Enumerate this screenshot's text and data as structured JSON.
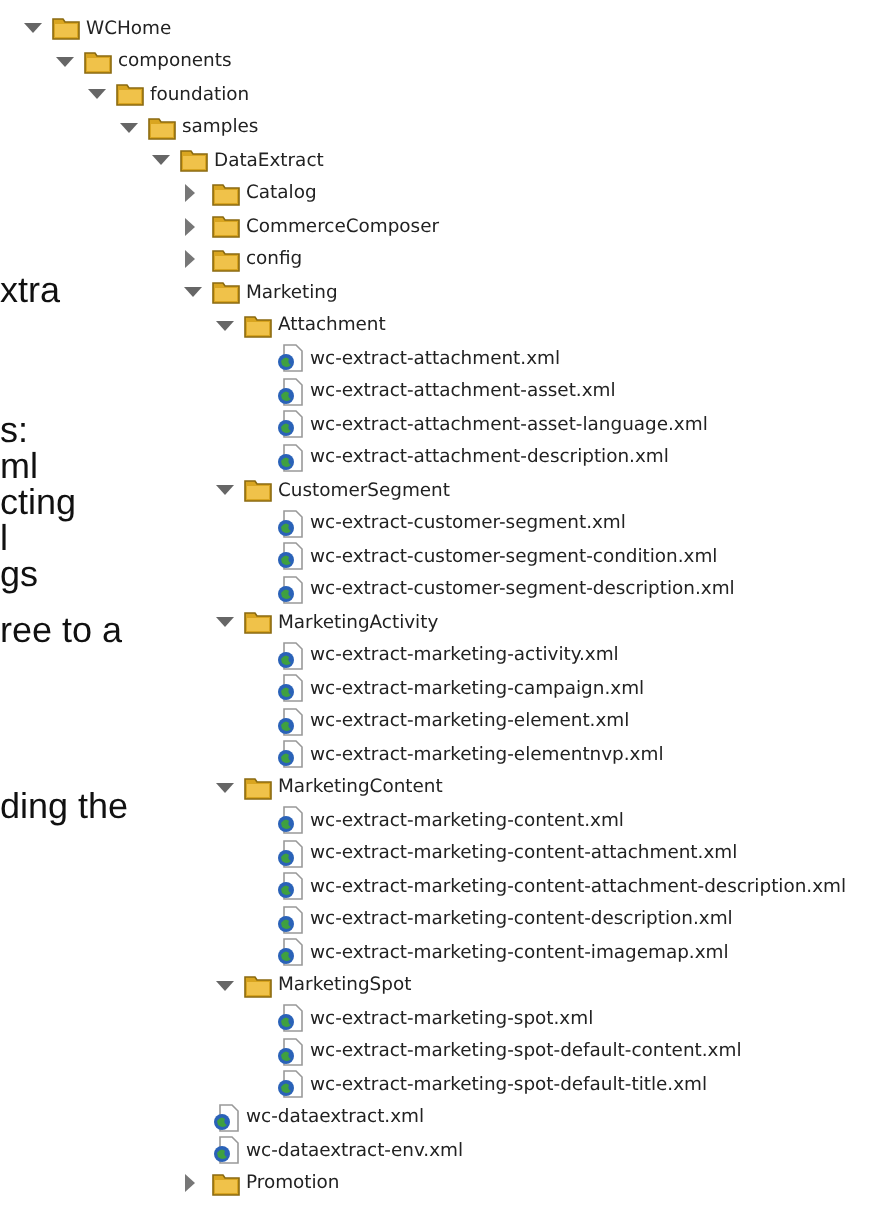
{
  "background_text": [
    "xtra",
    "s:",
    "ml",
    "cting",
    "l",
    "gs",
    "ree to a",
    "ding the"
  ],
  "tree": [
    {
      "label": "WCHome",
      "kind": "folder",
      "expanded": true,
      "children": [
        {
          "label": "components",
          "kind": "folder",
          "expanded": true,
          "children": [
            {
              "label": "foundation",
              "kind": "folder",
              "expanded": true,
              "children": [
                {
                  "label": "samples",
                  "kind": "folder",
                  "expanded": true,
                  "children": [
                    {
                      "label": "DataExtract",
                      "kind": "folder",
                      "expanded": true,
                      "children": [
                        {
                          "label": "Catalog",
                          "kind": "folder",
                          "expanded": false
                        },
                        {
                          "label": "CommerceComposer",
                          "kind": "folder",
                          "expanded": false
                        },
                        {
                          "label": "config",
                          "kind": "folder",
                          "expanded": false
                        },
                        {
                          "label": "Marketing",
                          "kind": "folder",
                          "expanded": true,
                          "children": [
                            {
                              "label": "Attachment",
                              "kind": "folder",
                              "expanded": true,
                              "children": [
                                {
                                  "label": "wc-extract-attachment.xml",
                                  "kind": "file"
                                },
                                {
                                  "label": "wc-extract-attachment-asset.xml",
                                  "kind": "file"
                                },
                                {
                                  "label": "wc-extract-attachment-asset-language.xml",
                                  "kind": "file"
                                },
                                {
                                  "label": "wc-extract-attachment-description.xml",
                                  "kind": "file"
                                }
                              ]
                            },
                            {
                              "label": "CustomerSegment",
                              "kind": "folder",
                              "expanded": true,
                              "children": [
                                {
                                  "label": "wc-extract-customer-segment.xml",
                                  "kind": "file"
                                },
                                {
                                  "label": "wc-extract-customer-segment-condition.xml",
                                  "kind": "file"
                                },
                                {
                                  "label": "wc-extract-customer-segment-description.xml",
                                  "kind": "file"
                                }
                              ]
                            },
                            {
                              "label": "MarketingActivity",
                              "kind": "folder",
                              "expanded": true,
                              "children": [
                                {
                                  "label": "wc-extract-marketing-activity.xml",
                                  "kind": "file"
                                },
                                {
                                  "label": "wc-extract-marketing-campaign.xml",
                                  "kind": "file"
                                },
                                {
                                  "label": "wc-extract-marketing-element.xml",
                                  "kind": "file"
                                },
                                {
                                  "label": "wc-extract-marketing-elementnvp.xml",
                                  "kind": "file"
                                }
                              ]
                            },
                            {
                              "label": "MarketingContent",
                              "kind": "folder",
                              "expanded": true,
                              "children": [
                                {
                                  "label": "wc-extract-marketing-content.xml",
                                  "kind": "file"
                                },
                                {
                                  "label": "wc-extract-marketing-content-attachment.xml",
                                  "kind": "file"
                                },
                                {
                                  "label": "wc-extract-marketing-content-attachment-description.xml",
                                  "kind": "file"
                                },
                                {
                                  "label": "wc-extract-marketing-content-description.xml",
                                  "kind": "file"
                                },
                                {
                                  "label": "wc-extract-marketing-content-imagemap.xml",
                                  "kind": "file"
                                }
                              ]
                            },
                            {
                              "label": "MarketingSpot",
                              "kind": "folder",
                              "expanded": true,
                              "children": [
                                {
                                  "label": "wc-extract-marketing-spot.xml",
                                  "kind": "file"
                                },
                                {
                                  "label": "wc-extract-marketing-spot-default-content.xml",
                                  "kind": "file"
                                },
                                {
                                  "label": "wc-extract-marketing-spot-default-title.xml",
                                  "kind": "file"
                                }
                              ]
                            }
                          ]
                        },
                        {
                          "label": "wc-dataextract.xml",
                          "kind": "file"
                        },
                        {
                          "label": "wc-dataextract-env.xml",
                          "kind": "file"
                        },
                        {
                          "label": "Promotion",
                          "kind": "folder",
                          "expanded": false
                        }
                      ]
                    }
                  ]
                }
              ]
            }
          ]
        }
      ]
    }
  ]
}
